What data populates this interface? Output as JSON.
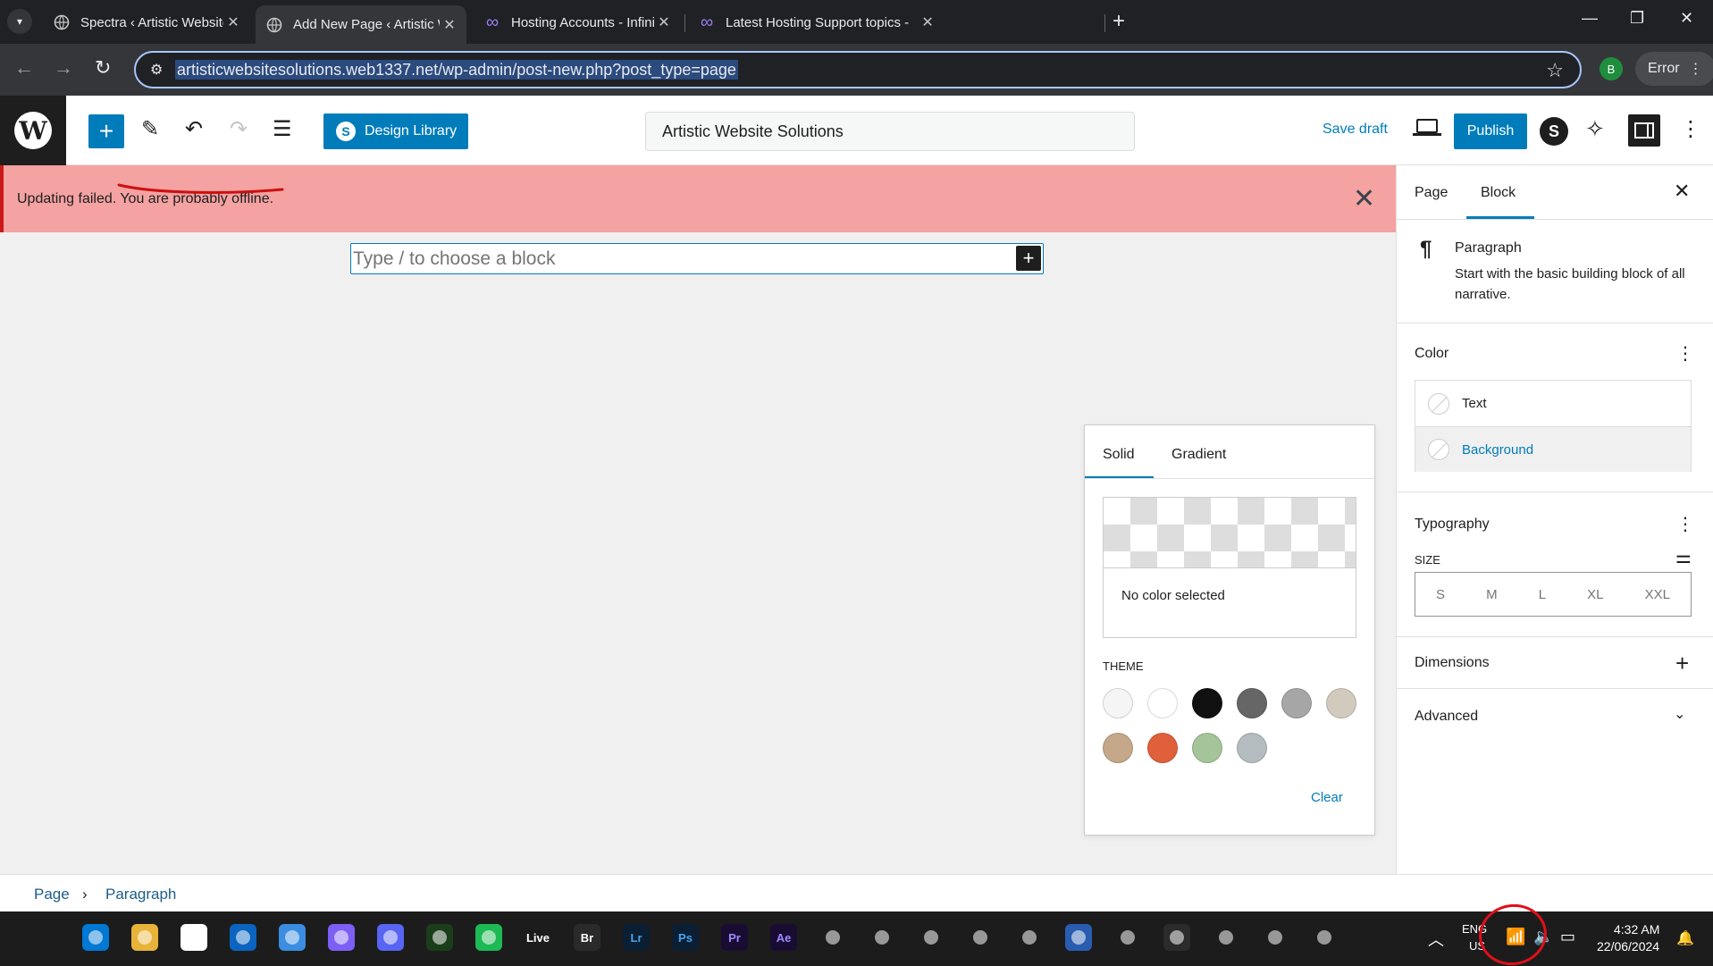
{
  "browser": {
    "tabs": [
      {
        "label": "Spectra ‹ Artistic Website Soluti",
        "icon": "globe-icon",
        "active": false
      },
      {
        "label": "Add New Page ‹ Artistic Websit",
        "icon": "globe-icon",
        "active": true
      },
      {
        "label": "Hosting Accounts - InfinityFree",
        "icon": "infinity-icon",
        "active": false
      },
      {
        "label": "Latest Hosting Support topics -",
        "icon": "infinity-icon",
        "active": false
      }
    ],
    "url": "artisticwebsitesolutions.web1337.net/wp-admin/post-new.php?post_type=page",
    "profile_initial": "B",
    "error_label": "Error"
  },
  "wp": {
    "design_library_label": "Design Library",
    "document_title": "Artistic Website Solutions",
    "save_draft_label": "Save draft",
    "publish_label": "Publish",
    "spectra_letter": "S"
  },
  "notice": {
    "text": "Updating failed. You are probably offline."
  },
  "editor": {
    "block_placeholder": "Type / to choose a block"
  },
  "color_popover": {
    "tabs": [
      "Solid",
      "Gradient"
    ],
    "no_color_text": "No color selected",
    "theme_label": "THEME",
    "clear_label": "Clear",
    "swatches": [
      "#f5f5f5",
      "#ffffff",
      "#111111",
      "#666666",
      "#a6a6a6",
      "#d1cbbd",
      "#c5a88a",
      "#e0603b",
      "#a6c49a",
      "#b4bcbf"
    ]
  },
  "sidebar": {
    "tabs": [
      "Page",
      "Block"
    ],
    "block_name": "Paragraph",
    "block_description": "Start with the basic building block of all narrative.",
    "color_heading": "Color",
    "color_items": [
      "Text",
      "Background"
    ],
    "typography_heading": "Typography",
    "size_label": "SIZE",
    "size_options": [
      "S",
      "M",
      "L",
      "XL",
      "XXL"
    ],
    "dimensions_heading": "Dimensions",
    "advanced_heading": "Advanced"
  },
  "breadcrumb": [
    "Page",
    "Paragraph"
  ],
  "taskbar": {
    "language_line1": "ENG",
    "language_line2": "US",
    "time": "4:32 AM",
    "date": "22/06/2024",
    "apps": [
      "start-icon",
      "file-explorer-icon",
      "chrome-icon",
      "outlook-icon",
      "store-icon",
      "messenger-icon",
      "discord-icon",
      "terminal-icon",
      "spotify-icon",
      "live-icon",
      "bridge-icon",
      "lightroom-icon",
      "photoshop-icon",
      "premiere-icon",
      "after-effects-icon",
      "obs-icon",
      "app-icon",
      "app-icon",
      "app-icon",
      "app-icon",
      "app-icon",
      "app-icon",
      "app-icon",
      "app-icon",
      "chrome-profile-icon",
      "snipping-icon"
    ],
    "app_labels": [
      "",
      "",
      "",
      "",
      "",
      "",
      "",
      "",
      "",
      "Live",
      "Br",
      "Lr",
      "Ps",
      "Pr",
      "Ae",
      "",
      "",
      "",
      "",
      "",
      "",
      "",
      "",
      "",
      "",
      ""
    ]
  }
}
